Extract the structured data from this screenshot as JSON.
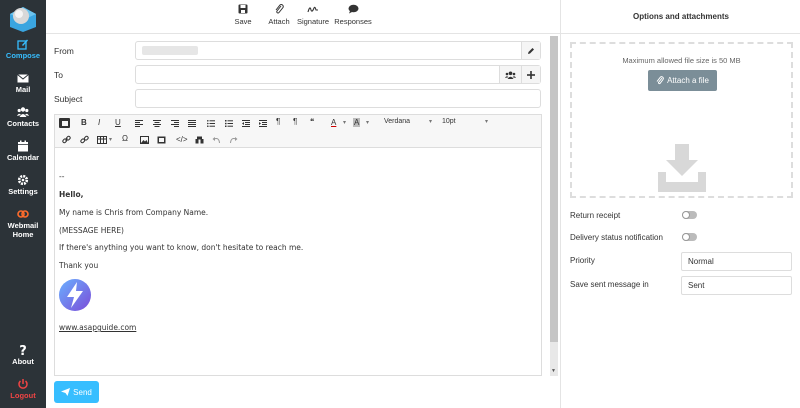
{
  "sidebar": {
    "items": [
      {
        "label": "Compose",
        "icon": "compose-icon"
      },
      {
        "label": "Mail",
        "icon": "envelope-icon"
      },
      {
        "label": "Contacts",
        "icon": "users-icon"
      },
      {
        "label": "Calendar",
        "icon": "calendar-icon"
      },
      {
        "label": "Settings",
        "icon": "gear-icon"
      },
      {
        "label": "Webmail",
        "label2": "Home",
        "icon": "cpanel-icon"
      }
    ],
    "bottom": [
      {
        "label": "About",
        "icon": "question-icon"
      },
      {
        "label": "Logout",
        "icon": "power-icon"
      }
    ],
    "colors": {
      "bg": "#2c3338",
      "active": "#37beff",
      "logout": "#ee4444"
    }
  },
  "toolbar": {
    "save": "Save",
    "attach": "Attach",
    "signature": "Signature",
    "responses": "Responses"
  },
  "form": {
    "from_label": "From",
    "from_value": "",
    "to_label": "To",
    "to_value": "",
    "subject_label": "Subject",
    "subject_value": ""
  },
  "editor": {
    "font_name": "Verdana",
    "font_size": "10pt",
    "bold": "B",
    "italic": "I",
    "underline": "U",
    "text_color": "A",
    "omega": "Ω",
    "pilcrow": "¶",
    "quote": "❝",
    "body": {
      "separator": "--",
      "greeting": "Hello,",
      "line1": "My name is Chris from Company Name.",
      "line2": "(MESSAGE HERE)",
      "line3": "If there's anything you want to know, don't hesitate to reach me.",
      "line4": "Thank you",
      "link": "www.asapguide.com"
    }
  },
  "send_label": "Send",
  "right_panel": {
    "title": "Options and attachments",
    "max_size": "Maximum allowed file size is 50 MB",
    "attach_label": "Attach a file",
    "return_receipt": "Return receipt",
    "delivery_status": "Delivery status notification",
    "priority_label": "Priority",
    "priority_value": "Normal",
    "save_sent_label": "Save sent message in",
    "save_sent_value": "Sent"
  }
}
